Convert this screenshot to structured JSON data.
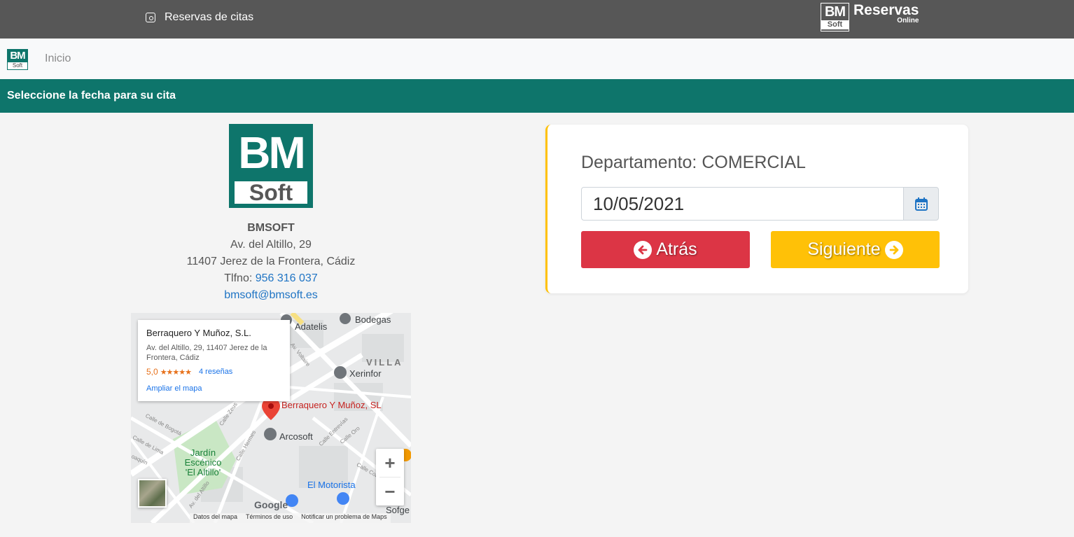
{
  "topbar": {
    "title": "Reservas de citas",
    "logo_bm": "BM",
    "logo_soft": "Soft",
    "brand_main": "Reservas",
    "brand_sub": "Online"
  },
  "nav": {
    "logo_bm": "BM",
    "logo_soft": "Soft",
    "inicio": "Inicio"
  },
  "banner": {
    "text": "Seleccione la fecha para su cita"
  },
  "company": {
    "logo_bm": "BM",
    "logo_soft": "Soft",
    "name": "BMSOFT",
    "address1": "Av. del Altillo, 29",
    "address2": "11407 Jerez de la Frontera, Cádiz",
    "phone_label": "Tlfno:",
    "phone": "956 316 037",
    "email": "bmsoft@bmsoft.es"
  },
  "map": {
    "card_title": "Berraquero Y Muñoz, S.L.",
    "card_address": "Av. del Altillo, 29, 11407 Jerez de la Frontera, Cádiz",
    "card_score": "5,0",
    "card_stars": "★★★★★",
    "card_reviews": "4 reseñas",
    "card_enlarge": "Ampliar el mapa",
    "pin_label": "Berraquero Y Muñoz, SL",
    "labels": {
      "adatelis": "Adatelis",
      "bodegas": "Bodegas",
      "villa": "VILLA",
      "xerinfor": "Xerinfor",
      "arcosoft": "Arcosoft",
      "jardin": "Jardín Escénico 'El Altillo'",
      "motorista": "El Motorista",
      "sofge": "Sofge",
      "voltaire": "Av. Voltaire",
      "zeus": "Calle Zeus",
      "bogota": "Calle de Bogotá",
      "lima": "Calle de Lima",
      "hermes": "Calle Hermes",
      "entrevias": "Calle Entrevías",
      "oro": "Calle Oro",
      "cobre": "Calle Cobre",
      "altillo": "Av. del Altillo",
      "joaquin": "oaquín"
    },
    "zoom_in": "+",
    "zoom_out": "−",
    "google": "Google",
    "footer_data": "Datos del mapa",
    "footer_terms": "Términos de uso",
    "footer_report": "Notificar un problema de Maps"
  },
  "form": {
    "department": "Departamento: COMERCIAL",
    "date_value": "10/05/2021",
    "back_label": "Atrás",
    "next_label": "Siguiente"
  },
  "colors": {
    "topbar": "#575757",
    "brand_green": "#0e756b",
    "back_button": "#dc3545",
    "next_button": "#ffc107",
    "link": "#1f74c4"
  },
  "icons": [
    "clock-icon",
    "calendar-icon",
    "arrow-left-circle-icon",
    "arrow-right-circle-icon",
    "map-pin-icon"
  ]
}
